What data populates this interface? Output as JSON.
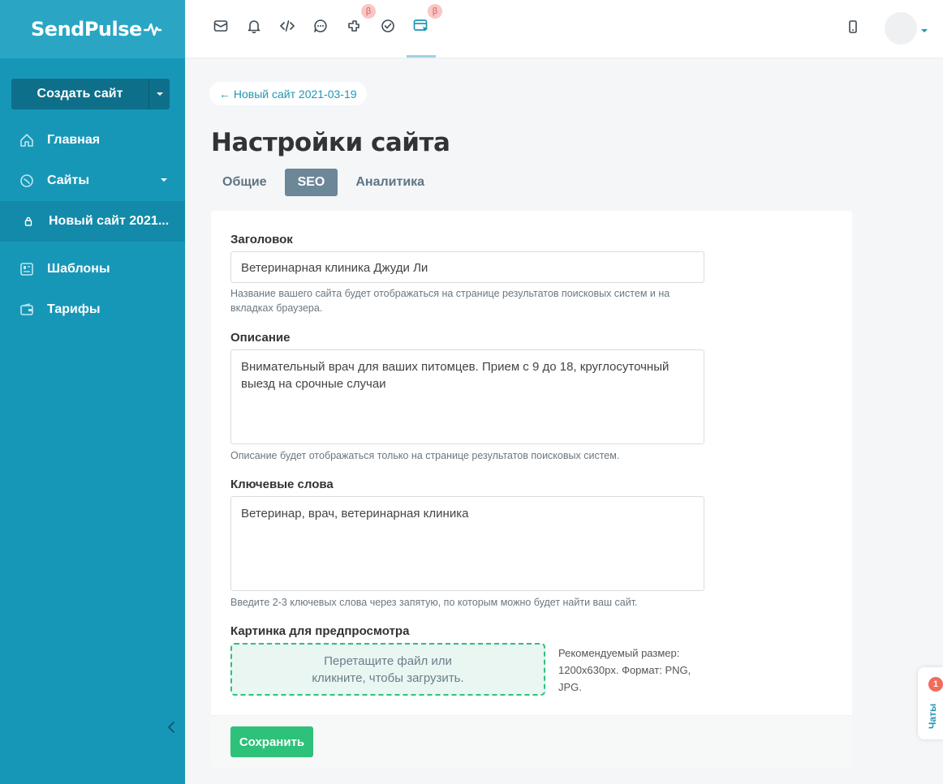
{
  "app": {
    "logo": "SendPulse"
  },
  "sidebar": {
    "create_button": "Создать сайт",
    "items": [
      {
        "label": "Главная",
        "icon": "home-icon"
      },
      {
        "label": "Сайты",
        "icon": "sites-icon"
      },
      {
        "label": "Новый сайт 2021...",
        "icon": "lock-icon"
      },
      {
        "label": "Шаблоны",
        "icon": "templates-icon"
      },
      {
        "label": "Тарифы",
        "icon": "wallet-icon"
      }
    ]
  },
  "topbar": {
    "icons": [
      "email-icon",
      "bell-icon",
      "code-icon",
      "chat-bubble-icon",
      "automation-icon",
      "check-circle-icon",
      "site-builder-icon"
    ],
    "beta_label": "β"
  },
  "main": {
    "back_link": "← Новый сайт 2021-03-19",
    "title": "Настройки сайта",
    "tabs": [
      "Общие",
      "SEO",
      "Аналитика"
    ],
    "active_tab": "SEO"
  },
  "form": {
    "title_label": "Заголовок",
    "title_value": "Ветеринарная клиника Джуди Ли",
    "title_hint": "Название вашего сайта будет отображаться на странице результатов поисковых систем и на вкладках браузера.",
    "description_label": "Описание",
    "description_value": "Внимательный врач для ваших питомцев. Прием с 9 до 18, круглосуточный выезд на срочные случаи",
    "description_hint": "Описание будет отображаться только на странице результатов поисковых систем.",
    "keywords_label": "Ключевые слова",
    "keywords_value": "Ветеринар, врач, ветеринарная клиника",
    "keywords_hint": "Введите 2-3 ключевых слова через запятую, по которым можно будет найти ваш сайт.",
    "image_label": "Картинка для предпросмотра",
    "dropzone_text_1": "Перетащите файл или",
    "dropzone_text_2": "кликните, чтобы загрузить.",
    "image_hint": "Рекомендуемый размер: 1200x630px. Формат: PNG, JPG.",
    "save_button": "Сохранить"
  },
  "chat_widget": {
    "label": "Чаты",
    "count": "1"
  },
  "colors": {
    "sidebar": "#1797b8",
    "accent": "#1f97b4",
    "save": "#2ec179",
    "active_tab": "#6c8797"
  }
}
